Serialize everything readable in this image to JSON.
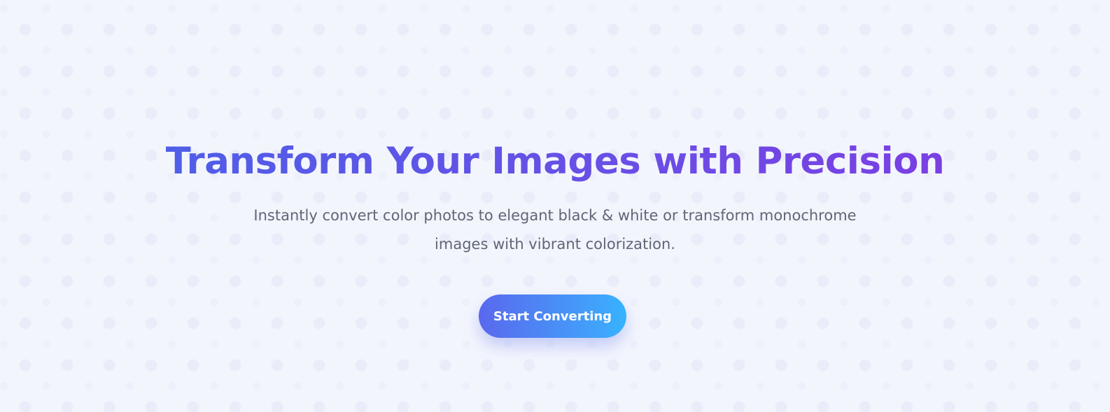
{
  "hero": {
    "title": "Transform Your Images with Precision",
    "subtitle": "Instantly convert color photos to elegant black & white or transform monochrome images with vibrant colorization.",
    "cta_label": "Start Converting"
  },
  "colors": {
    "background": "#f3f5fd",
    "title_gradient_start": "#4f5ee8",
    "title_gradient_end": "#7a3fe3",
    "subtitle_text": "#5f6675",
    "button_gradient_start": "#5a68ee",
    "button_gradient_end": "#35b4ff",
    "button_text": "#ffffff"
  }
}
